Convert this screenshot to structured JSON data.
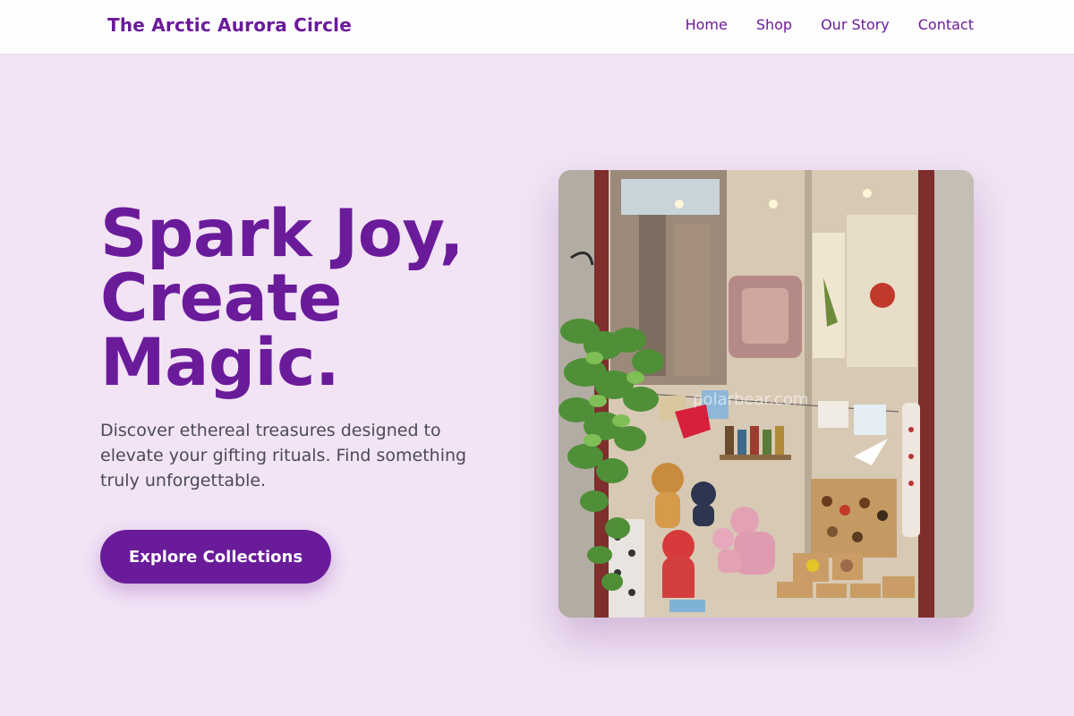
{
  "brand": {
    "name": "The Arctic Aurora Circle"
  },
  "nav": {
    "links": [
      {
        "label": "Home"
      },
      {
        "label": "Shop"
      },
      {
        "label": "Our Story"
      },
      {
        "label": "Contact"
      }
    ]
  },
  "hero": {
    "heading_lines": [
      "Spark Joy,",
      "Create",
      "Magic."
    ],
    "tagline": "Discover ethereal treasures designed to elevate your gifting rituals. Find something truly unforgettable.",
    "cta_label": "Explore Collections",
    "image": {
      "subject": "shop-window-photo",
      "watermark": "polarbear.com"
    }
  },
  "colors": {
    "brand": "#6a1b9a",
    "page_background": "#f2e3f5",
    "navbar_background": "#fefdfe",
    "tagline_text": "#4a4a5c",
    "button_text": "#ffffff"
  }
}
